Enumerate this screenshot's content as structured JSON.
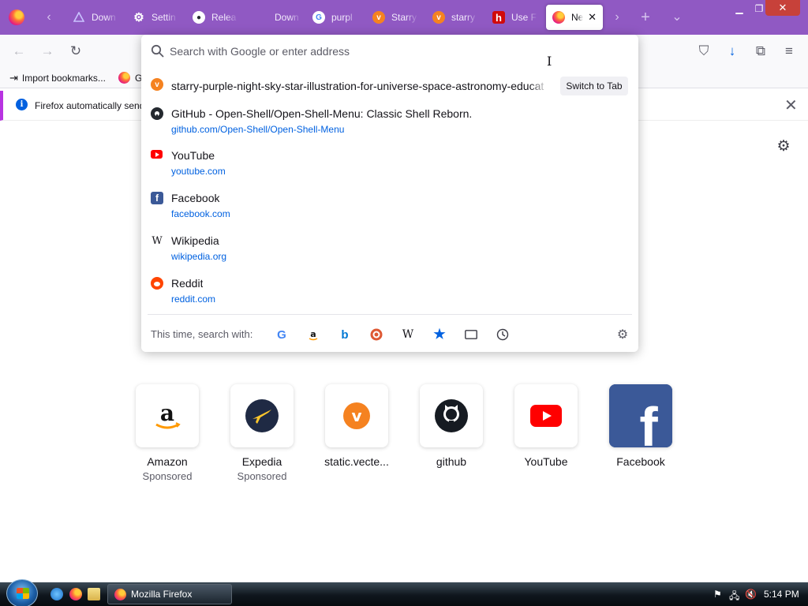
{
  "tabs": [
    {
      "title": "Down",
      "icon": "drive-icon",
      "color": "#9aa8ff"
    },
    {
      "title": "Settin",
      "icon": "gear-icon",
      "color": "#ffffff"
    },
    {
      "title": "Relea",
      "icon": "github-icon",
      "color": "#ffffff"
    },
    {
      "title": "Down",
      "icon": "blank-icon",
      "color": "#9059c3"
    },
    {
      "title": "purpl",
      "icon": "google-icon",
      "color": "#ffffff"
    },
    {
      "title": "Starry",
      "icon": "vecteezy-icon",
      "color": "#f58220"
    },
    {
      "title": "starry",
      "icon": "vecteezy-icon",
      "color": "#f58220"
    },
    {
      "title": "Use F",
      "icon": "h-icon",
      "color": "#d10a0a"
    },
    {
      "title": "Ne",
      "icon": "firefox-icon",
      "color": "#ff7139",
      "active": true
    }
  ],
  "nav": {
    "back": "←",
    "forward": "→",
    "reload": "↻",
    "pocket": "⛉",
    "downloads": "↓",
    "extensions": "⧉",
    "menu": "≡"
  },
  "bookmarks": {
    "import_label": "Import bookmarks...",
    "second_label": "G"
  },
  "infobar": {
    "text": "Firefox automatically send"
  },
  "urlbar": {
    "placeholder": "Search with Google or enter address",
    "switch_label": "Switch to Tab",
    "suggestions": [
      {
        "title": "starry-purple-night-sky-star-illustration-for-universe-space-astronomy-educat",
        "url": "",
        "icon": "vecteezy-icon",
        "color": "#f58220"
      },
      {
        "title": "GitHub - Open-Shell/Open-Shell-Menu: Classic Shell Reborn.",
        "url": "github.com/Open-Shell/Open-Shell-Menu",
        "icon": "github-icon",
        "color": "#24292f"
      },
      {
        "title": "YouTube",
        "url": "youtube.com",
        "icon": "youtube-icon",
        "color": "#ff0000"
      },
      {
        "title": "Facebook",
        "url": "facebook.com",
        "icon": "facebook-icon",
        "color": "#3b5998"
      },
      {
        "title": "Wikipedia",
        "url": "wikipedia.org",
        "icon": "wikipedia-icon",
        "color": "#15141a"
      },
      {
        "title": "Reddit",
        "url": "reddit.com",
        "icon": "reddit-icon",
        "color": "#ff4500"
      }
    ],
    "one_off_label": "This time, search with:",
    "engines": [
      "google-icon",
      "amazon-icon",
      "bing-icon",
      "duckduckgo-icon",
      "wikipedia-icon",
      "bookmarks-icon",
      "tabs-icon",
      "history-icon"
    ]
  },
  "top_sites": [
    {
      "name": "Amazon",
      "sub": "Sponsored",
      "icon": "amazon-icon"
    },
    {
      "name": "Expedia",
      "sub": "Sponsored",
      "icon": "expedia-icon"
    },
    {
      "name": "static.vecte...",
      "sub": "",
      "icon": "vecteezy-icon"
    },
    {
      "name": "github",
      "sub": "",
      "icon": "github-icon"
    },
    {
      "name": "YouTube",
      "sub": "",
      "icon": "youtube-icon"
    },
    {
      "name": "Facebook",
      "sub": "",
      "icon": "facebook-icon"
    }
  ],
  "taskbar": {
    "task_label": "Mozilla Firefox",
    "clock": "5:14 PM"
  },
  "colors": {
    "tabbar": "#9059c3",
    "accent": "#0061e0"
  }
}
